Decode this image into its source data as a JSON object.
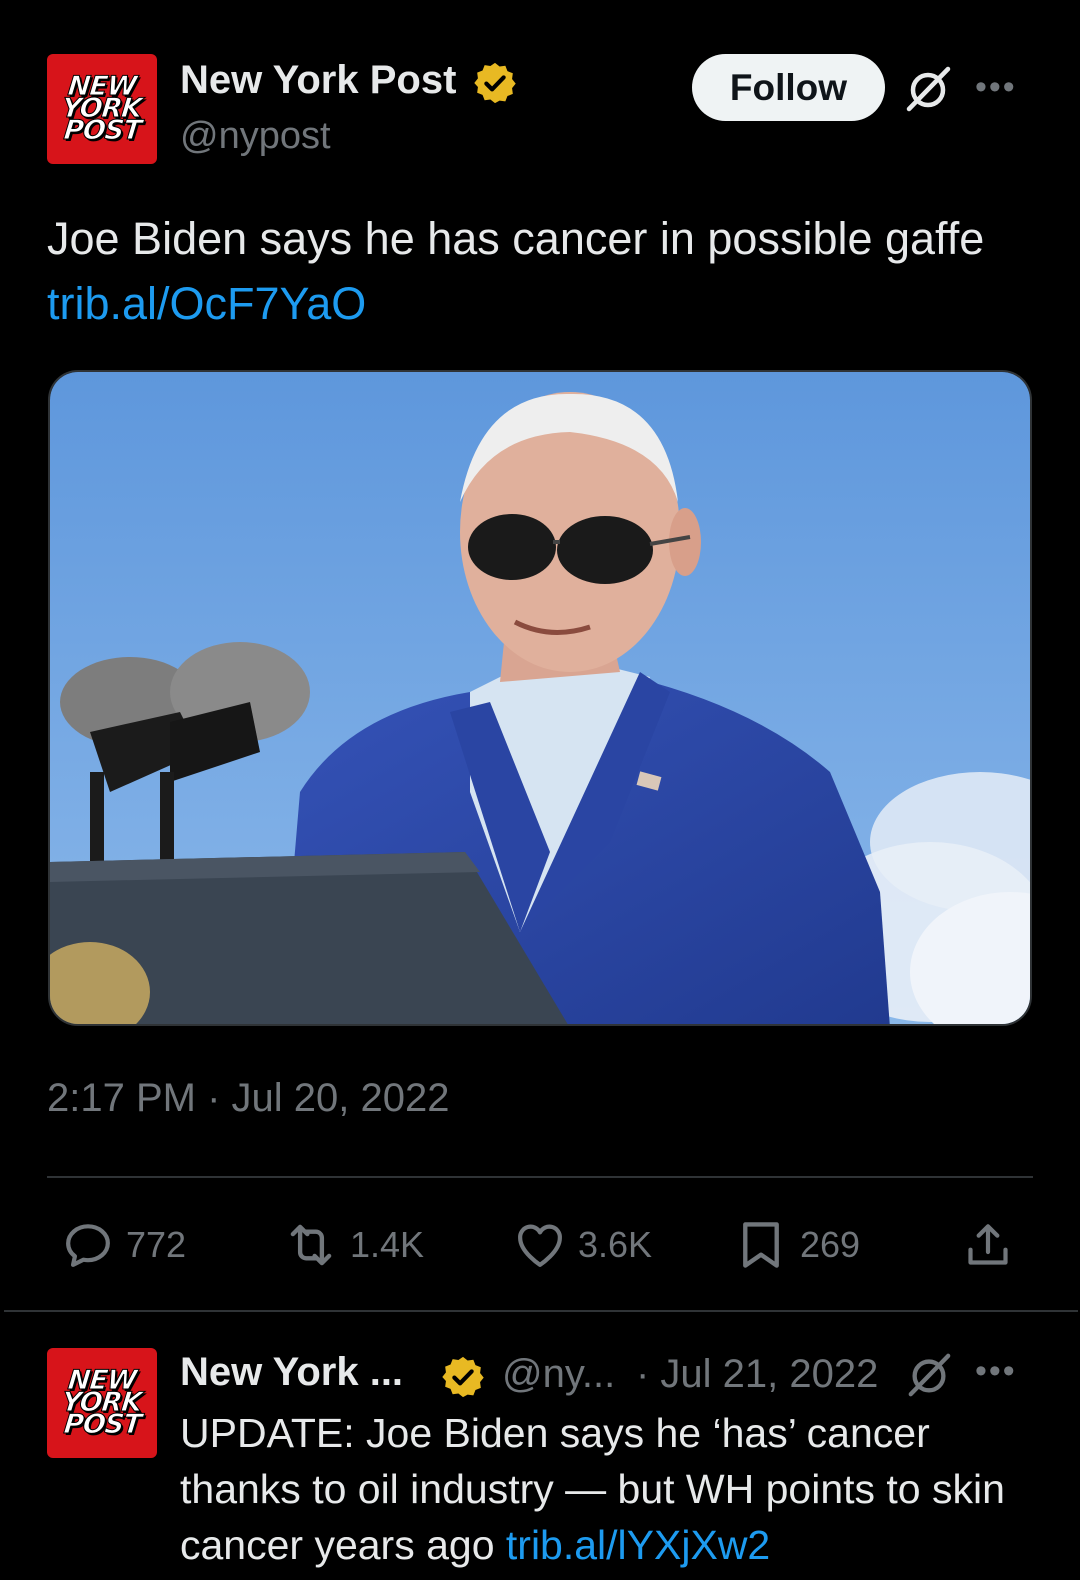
{
  "tweet": {
    "author": {
      "name": "New York Post",
      "handle": "@nypost",
      "avatar_lines": [
        "NEW",
        "YORK",
        "POST"
      ],
      "verified_color": "#e8b923"
    },
    "follow_label": "Follow",
    "text": "Joe Biden says he has cancer in possible gaffe ",
    "link": "trib.al/OcF7YaO",
    "timestamp": "2:17 PM · Jul 20, 2022",
    "actions": {
      "replies": "772",
      "reposts": "1.4K",
      "likes": "3.6K",
      "bookmarks": "269"
    }
  },
  "reply": {
    "author": {
      "name": "New York ...",
      "handle": "@ny...",
      "avatar_lines": [
        "NEW",
        "YORK",
        "POST"
      ]
    },
    "date": "· Jul 21, 2022",
    "text": "UPDATE: Joe Biden says he ‘has’ cancer thanks to oil industry — but WH points to skin cancer years ago ",
    "link": "trib.al/lYXjXw2"
  },
  "icons": {
    "verified": "verified-badge-icon",
    "grok": "grok-icon",
    "more": "more-icon",
    "reply": "reply-icon",
    "repost": "repost-icon",
    "like": "heart-icon",
    "bookmark": "bookmark-icon",
    "share": "share-icon"
  },
  "colors": {
    "background": "#000000",
    "link": "#1d9bf0",
    "muted": "#71767b",
    "brand_red": "#d7141a"
  }
}
